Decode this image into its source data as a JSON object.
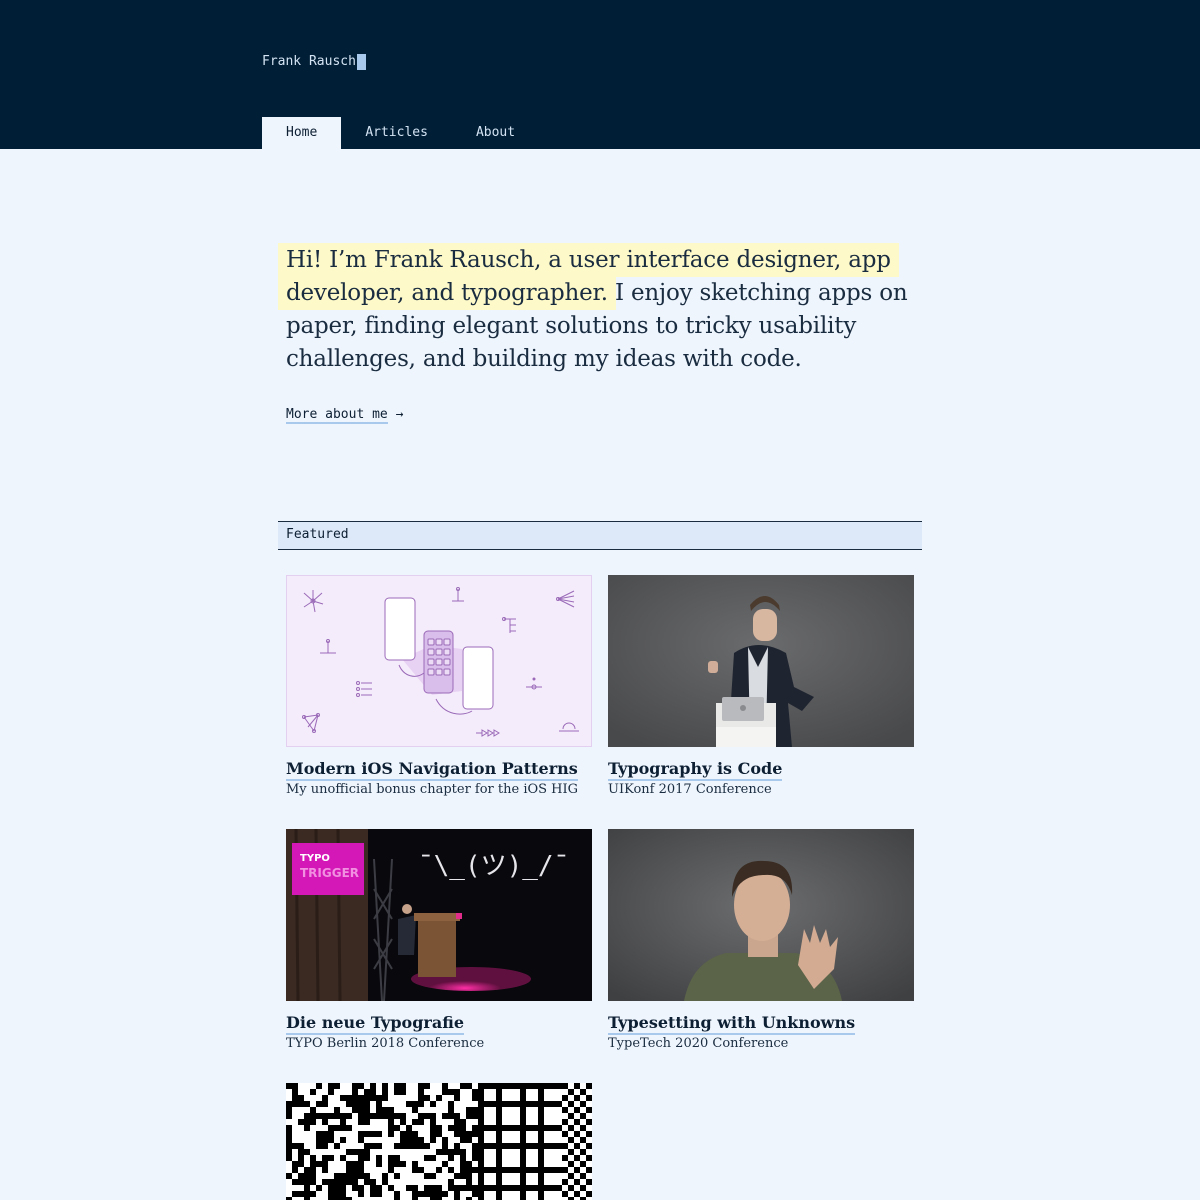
{
  "header": {
    "site_name": "Frank Rausch",
    "nav": [
      {
        "label": "Home",
        "active": true
      },
      {
        "label": "Articles",
        "active": false
      },
      {
        "label": "About",
        "active": false
      }
    ]
  },
  "intro": {
    "highlight": "Hi! I’m Frank Rausch, a user interface designer, app developer, and typographer.",
    "rest": " I enjoy sketching apps on paper, finding elegant solutions to tricky usability challenges, and building my ideas with code.",
    "more_link": "More about me",
    "more_arrow": "→"
  },
  "featured": {
    "heading": "Featured",
    "items": [
      {
        "title": "Modern iOS Navigation Patterns",
        "subtitle": "My unofficial bonus chapter for the iOS HIG"
      },
      {
        "title": "Typography is Code",
        "subtitle": "UIKonf 2017 Conference"
      },
      {
        "title": "Die neue Typografie",
        "subtitle": "TYPO Berlin 2018 Conference",
        "screen_text_1": "TYPO",
        "screen_text_2": "TRIGGER",
        "kaomoji": "¯\\_(ツ)_/¯"
      },
      {
        "title": "Typesetting with Unknowns",
        "subtitle": "TypeTech 2020 Conference"
      }
    ]
  },
  "colors": {
    "header_bg": "#001e36",
    "page_bg": "#eef5fd",
    "highlight": "#fdf9c8",
    "link_underline": "#a8c8ec",
    "accent_purple": "#9a6ab8"
  }
}
